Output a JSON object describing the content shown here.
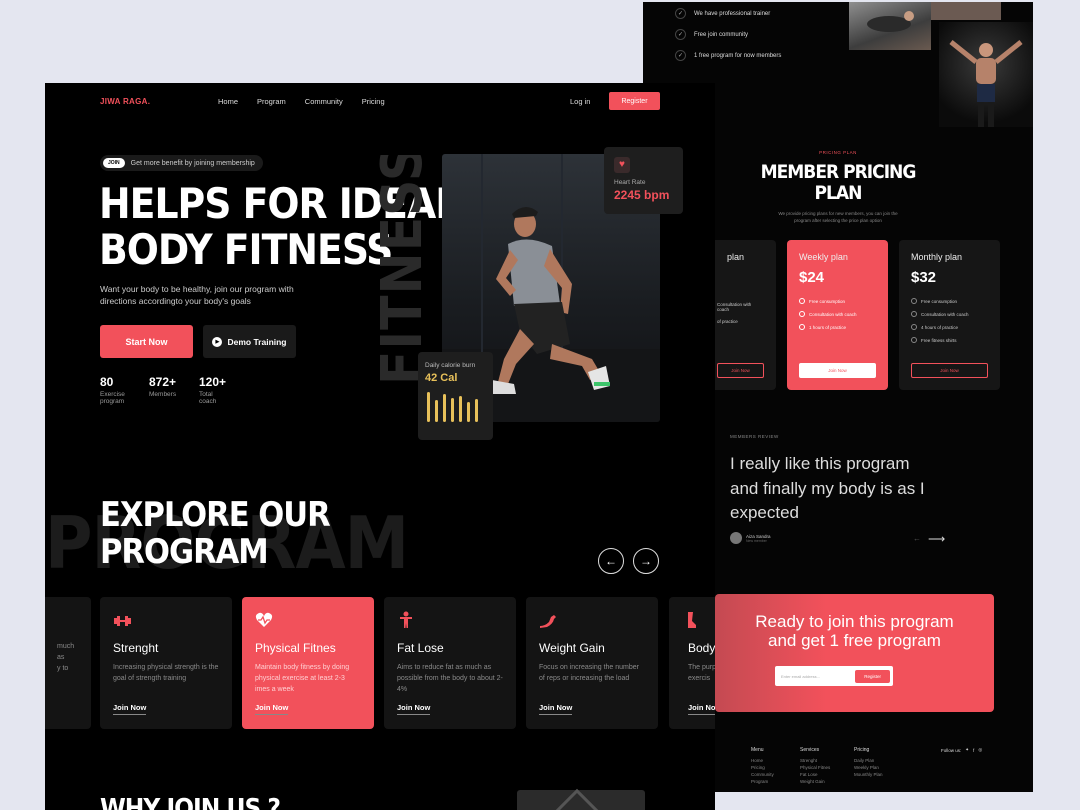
{
  "back": {
    "features": [
      "We have professional trainer",
      "Free join community",
      "1 free program for now members"
    ],
    "pricing_kicker": "PRICING PLAN",
    "pricing_title_1": "MEMBER PRICING",
    "pricing_title_2": "PLAN",
    "pricing_sub_1": "We provide pricing plans for new members, you can join the",
    "pricing_sub_2": "program after selecting the price plan option",
    "plans": [
      {
        "name": "plan",
        "price": "",
        "features": [
          "",
          "Consultation with coach",
          "of practice"
        ],
        "button": "Join Now"
      },
      {
        "name": "Weekly plan",
        "price": "$24",
        "features": [
          "Free consumption",
          "Consultation with coach",
          "1 hours of practice"
        ],
        "button": "Join Now"
      },
      {
        "name": "Monthly plan",
        "price": "$32",
        "features": [
          "Free consumption",
          "Consultation with coach",
          "4 hours of practice",
          "Free fitness shirts"
        ],
        "button": "Join Now"
      }
    ],
    "review_kicker": "MEMBERS REVIEW",
    "review_1": "I really like this program",
    "review_2": "and finally my body is as I",
    "review_3": "expected",
    "reviewer_name": "Aiza Sandra",
    "reviewer_role": "New member",
    "cta_1": "Ready to join this program",
    "cta_2": "and get 1 free program",
    "cta_placeholder": "Enter email address...",
    "cta_button": "Register",
    "footer": {
      "menu": {
        "title": "Menu",
        "items": [
          "Home",
          "Pricing",
          "Community",
          "Program"
        ]
      },
      "services": {
        "title": "Services",
        "items": [
          "Strenght",
          "Physical Fitnes",
          "Fat Lose",
          "Weight Gain"
        ]
      },
      "pricing": {
        "title": "Pricing",
        "items": [
          "Daily Plan",
          "Weekly Plan",
          "Mounthly Plan"
        ]
      },
      "follow": "Follow us:"
    }
  },
  "front": {
    "brand": "JIWA RAGA.",
    "nav": [
      "Home",
      "Program",
      "Community",
      "Pricing"
    ],
    "login": "Log in",
    "register": "Register",
    "badge_tag": "JOIN",
    "badge_text": "Get more benefit by joining membership",
    "hero_1": "HELPS FOR IDEAL",
    "hero_2": "BODY FITNESS",
    "hero_sub_1": "Want your body to be healthy, join our program with",
    "hero_sub_2": "directions accordingto your body's goals",
    "start": "Start Now",
    "demo": "Demo Training",
    "stats": [
      {
        "n": "80",
        "l1": "Exercise",
        "l2": "program"
      },
      {
        "n": "872+",
        "l1": "Members",
        "l2": ""
      },
      {
        "n": "120+",
        "l1": "Total",
        "l2": "coach"
      }
    ],
    "watermark": "FITNESS",
    "heart_label": "Heart Rate",
    "heart_value": "2245 bpm",
    "cal_label": "Daily calorie burn",
    "cal_value": "42 Cal",
    "explore_1": "EXPLORE OUR",
    "explore_2": "PROGRAM",
    "explore_watermark": "PROGRAM",
    "cards": [
      {
        "title": "",
        "desc": "much as\ny to",
        "link": "Join Now"
      },
      {
        "title": "Strenght",
        "desc": "Increasing physical strength is the goal of strength training",
        "link": "Join Now"
      },
      {
        "title": "Physical Fitnes",
        "desc": "Maintain body fitness by doing physical exercise at least 2-3 imes a week",
        "link": "Join Now"
      },
      {
        "title": "Fat Lose",
        "desc": "Aims to reduce fat as much as possible from the body to about 2-4%",
        "link": "Join Now"
      },
      {
        "title": "Weight Gain",
        "desc": "Focus on increasing the number of reps or increasing the load",
        "link": "Join Now"
      },
      {
        "title": "Body",
        "desc": "The purp\nexercis",
        "link": "Join No"
      }
    ],
    "why": "WHY JOIN US ?"
  },
  "colors": {
    "accent": "#f2515b",
    "bg": "#000000",
    "page": "#e4e6f0",
    "gold": "#e8c15a"
  }
}
